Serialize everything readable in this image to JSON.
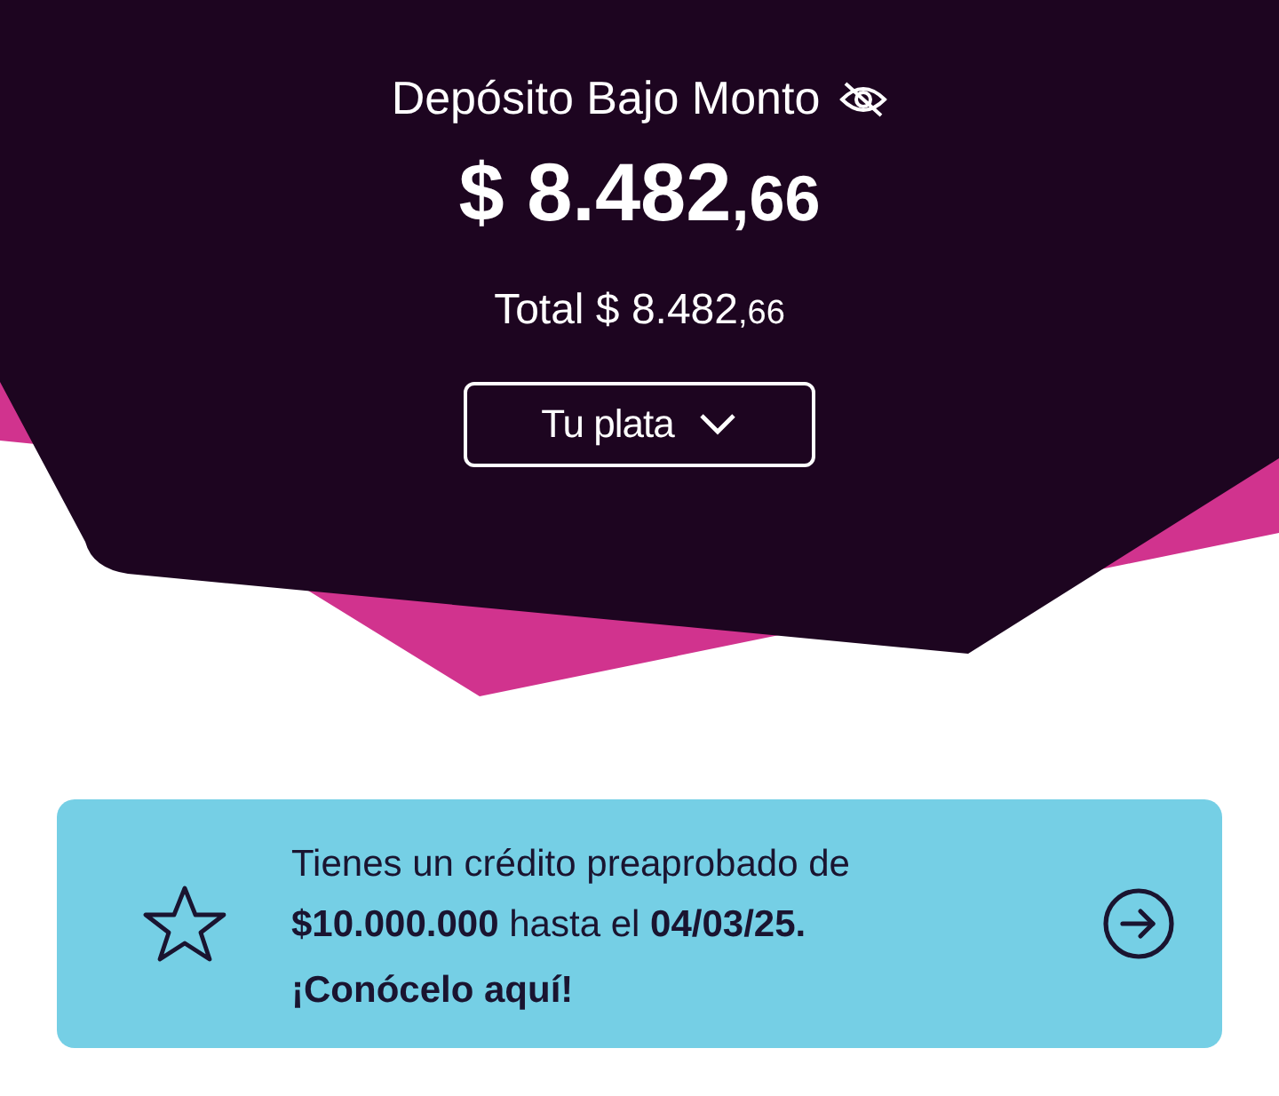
{
  "account": {
    "title": "Depósito Bajo Monto",
    "balance_hidden": false,
    "amount_main": "$ 8.482",
    "amount_decimals": ",66",
    "total_main": "Total $ 8.482",
    "total_decimals": ",66"
  },
  "selector": {
    "label": "Tu plata"
  },
  "banner": {
    "message": "Tienes un crédito preaprobado de **$10.000.000** hasta el **04/03/25.**",
    "cta": "¡Conócelo aquí!"
  }
}
